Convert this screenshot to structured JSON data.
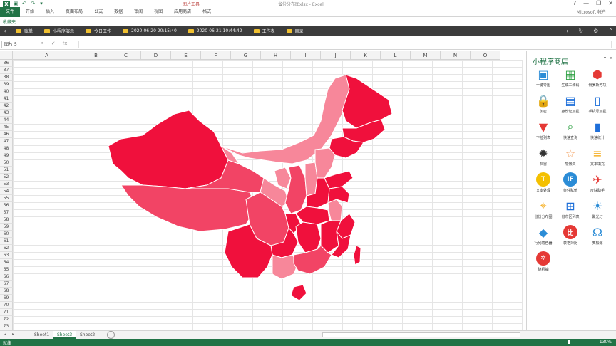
{
  "titlebar": {
    "context_tab": "图片工具",
    "window_title": "省份分布图xlsx - Excel",
    "controls": [
      "?",
      "—",
      "❐",
      "✕"
    ]
  },
  "ribbon": {
    "tabs": [
      "文件",
      "开始",
      "插入",
      "页面布局",
      "公式",
      "数据",
      "审阅",
      "视图",
      "应用商店",
      "格式"
    ],
    "account": "Microsoft 帐户"
  },
  "favorites": {
    "label": "收藏夹",
    "items": [
      "账单",
      "小程序演示",
      "今日工作",
      "2020-06-20 20:15:40",
      "2020-06-21 10:44:42",
      "工作表",
      "目录"
    ]
  },
  "formula_bar": {
    "name_box": "图片 5",
    "value": ""
  },
  "grid": {
    "columns": [
      "A",
      "B",
      "C",
      "D",
      "E",
      "F",
      "G",
      "H",
      "I",
      "J",
      "K",
      "L",
      "M",
      "N",
      "O"
    ],
    "rows": [
      "36",
      "37",
      "38",
      "39",
      "40",
      "41",
      "42",
      "43",
      "44",
      "45",
      "46",
      "47",
      "48",
      "49",
      "50",
      "51",
      "52",
      "53",
      "54",
      "55",
      "56",
      "57",
      "58",
      "59",
      "60",
      "61",
      "62",
      "63",
      "64",
      "65",
      "66",
      "67",
      "68",
      "69",
      "70",
      "71",
      "72",
      "73"
    ]
  },
  "map": {
    "colors": {
      "dark": "#f0103c",
      "mid": "#f24465",
      "light": "#f7879a",
      "border": "#ffffff"
    }
  },
  "side_panel": {
    "title": "小程序商店",
    "items": [
      {
        "label": "一键导图",
        "icon": "image-icon",
        "color": "#2b8cd6"
      },
      {
        "label": "生成二维码",
        "icon": "qrcode-icon",
        "color": "#2ea043"
      },
      {
        "label": "俄罗斯方块",
        "icon": "cube-icon",
        "color": "#e53935"
      },
      {
        "label": "加密",
        "icon": "lock-icon",
        "color": "#2ea043"
      },
      {
        "label": "身份证加星",
        "icon": "id-card-icon",
        "color": "#1e6fd9"
      },
      {
        "label": "手机号加星",
        "icon": "phone-icon",
        "color": "#1e6fd9"
      },
      {
        "label": "下拉列表",
        "icon": "dropdown-icon",
        "color": "#e53935"
      },
      {
        "label": "快速查询",
        "icon": "search-icon",
        "color": "#2ea043"
      },
      {
        "label": "快速统计",
        "icon": "bar-chart-icon",
        "color": "#1e6fd9"
      },
      {
        "label": "扫雷",
        "icon": "mine-icon",
        "color": "#333333"
      },
      {
        "label": "吸懒夹",
        "icon": "star-folder-icon",
        "color": "#f4a261"
      },
      {
        "label": "文本填充",
        "icon": "document-icon",
        "color": "#f4a300"
      },
      {
        "label": "文本处理",
        "icon": "text-t-icon",
        "color": "#f4c000"
      },
      {
        "label": "条件赋值",
        "icon": "if-icon",
        "color": "#2b8cd6"
      },
      {
        "label": "皮肤助手",
        "icon": "shirt-icon",
        "color": "#e53935"
      },
      {
        "label": "省份分布图",
        "icon": "map-pin-icon",
        "color": "#f4a300"
      },
      {
        "label": "省市区列表",
        "icon": "map-list-icon",
        "color": "#1e6fd9"
      },
      {
        "label": "聚光灯",
        "icon": "bulb-icon",
        "color": "#2b8cd6"
      },
      {
        "label": "行列着色器",
        "icon": "paint-bucket-icon",
        "color": "#2b8cd6"
      },
      {
        "label": "表格对比",
        "icon": "compare-icon",
        "color": "#e53935"
      },
      {
        "label": "奥松鲸",
        "icon": "ghost-icon",
        "color": "#2b8cd6"
      },
      {
        "label": "随机抽",
        "icon": "wheel-icon",
        "color": "#e53935"
      }
    ]
  },
  "sheets": {
    "tabs": [
      "Sheet1",
      "Sheet3",
      "Sheet2"
    ],
    "active": "Sheet3"
  },
  "status": {
    "left": "就绪",
    "zoom": "130%"
  }
}
